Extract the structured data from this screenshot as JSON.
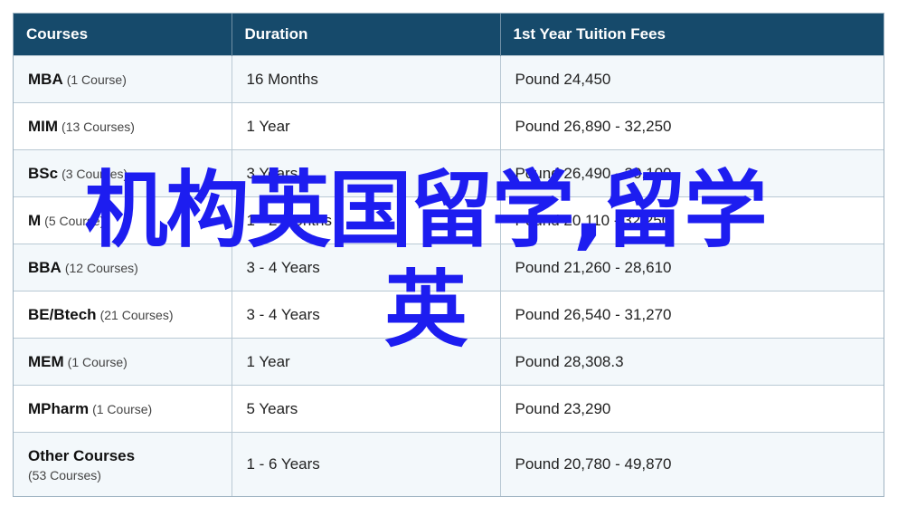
{
  "table": {
    "headers": [
      "Courses",
      "Duration",
      "1st Year Tuition Fees"
    ],
    "rows": [
      {
        "course": "MBA",
        "count": "(1 Course)",
        "duration": "16 Months",
        "fees": "Pound 24,450"
      },
      {
        "course": "MIM",
        "count": "(13 Courses)",
        "duration": "1 Year",
        "fees": "Pound 26,890 - 32,250"
      },
      {
        "course": "BSc",
        "count": "(3 Courses)",
        "duration": "3 Years",
        "fees": "Pound 26,490 - 30,100"
      },
      {
        "course": "M",
        "count": "(5 Course)",
        "duration": "1 - 2 Months",
        "fees": "Pound 20,110 - 32,250"
      },
      {
        "course": "BBA",
        "count": "(12 Courses)",
        "duration": "3 - 4 Years",
        "fees": "Pound 21,260 - 28,610"
      },
      {
        "course": "BE/Btech",
        "count": "(21 Courses)",
        "duration": "3 - 4 Years",
        "fees": "Pound 26,540 - 31,270"
      },
      {
        "course": "MEM",
        "count": "(1 Course)",
        "duration": "1 Year",
        "fees": "Pound 28,308.3"
      },
      {
        "course": "MPharm",
        "count": "(1 Course)",
        "duration": "5 Years",
        "fees": "Pound 23,290"
      },
      {
        "course": "Other Courses",
        "count": "(53 Courses)",
        "duration": "1 - 6 Years",
        "fees": "Pound 20,780 - 49,870"
      }
    ]
  },
  "overlay": {
    "line1": "机构英国留学,留学",
    "line2": "英"
  },
  "colors": {
    "header_bg": "#164a6b",
    "overlay_text": "#1d1df0",
    "row_alt": "#f3f8fb"
  }
}
